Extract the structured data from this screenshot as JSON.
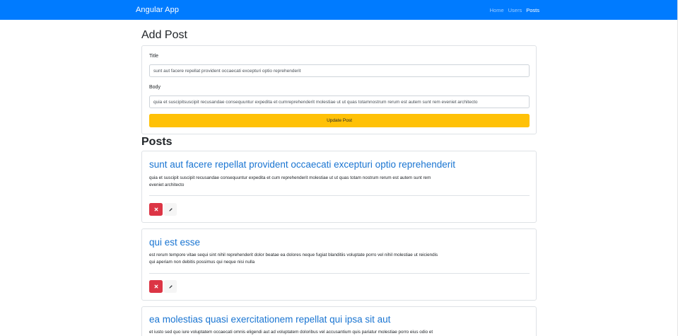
{
  "navbar": {
    "brand": "Angular App",
    "links": [
      {
        "label": "Home",
        "active": false
      },
      {
        "label": "Users",
        "active": false
      },
      {
        "label": "Posts",
        "active": true
      }
    ]
  },
  "form": {
    "heading": "Add Post",
    "title_label": "Title",
    "title_value": "sunt aut facere repellat provident occaecati excepturi optio reprehenderit",
    "body_label": "Body",
    "body_value": "quia et suscipitsuscipit recusandae consequuntur expedita et cumreprehenderit molestiae ut ut quas totamnostrum rerum est autem sunt rem eveniet architecto",
    "submit_label": "Update Post"
  },
  "posts_heading": "Posts",
  "posts": [
    {
      "title": "sunt aut facere repellat provident occaecati excepturi optio reprehenderit",
      "body_line1": "quia et suscipit suscipit recusandae consequuntur expedita et cum reprehenderit molestiae ut ut quas totam nostrum rerum est autem sunt rem",
      "body_line2": "eveniet architecto"
    },
    {
      "title": "qui est esse",
      "body_line1": "est rerum tempore vitae sequi sint nihil reprehenderit dolor beatae ea dolores neque fugiat blanditiis voluptate porro vel nihil molestiae ut reiciendis",
      "body_line2": "qui aperiam non debitis possimus qui neque nisi nulla"
    },
    {
      "title": "ea molestias quasi exercitationem repellat qui ipsa sit aut",
      "body_line1": "et iusto sed quo iure voluptatem occaecati omnis eligendi aut ad voluptatem doloribus vel accusantium quis pariatur molestiae porro eius odio et",
      "body_line2": ""
    }
  ],
  "icons": {
    "delete": "times-icon",
    "edit": "pencil-icon"
  },
  "colors": {
    "navbar": "#007bff",
    "update_button": "#ffc107",
    "delete_button": "#dc3545",
    "post_title": "#1a75d2"
  }
}
